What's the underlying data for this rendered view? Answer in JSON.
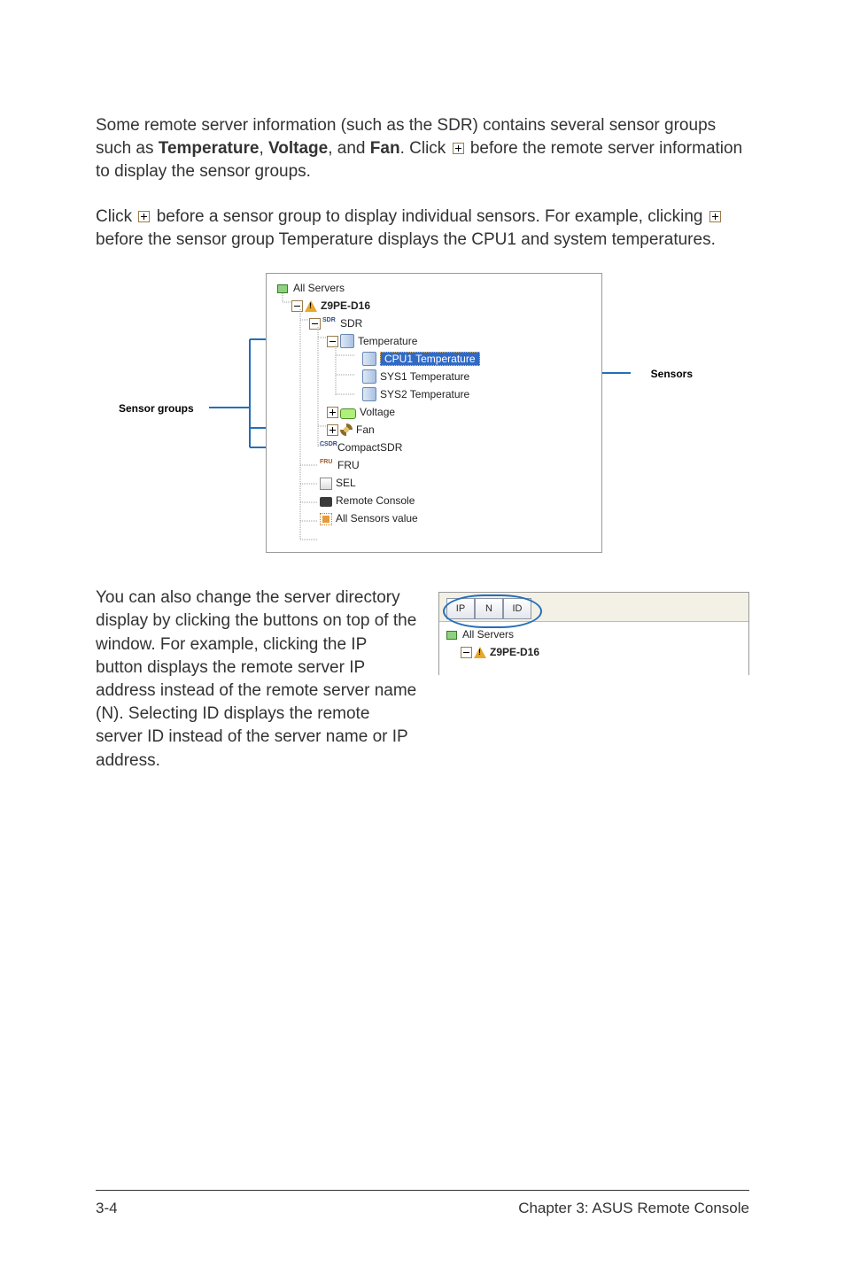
{
  "paragraphs": {
    "p1a": "Some remote server information (such as the SDR) contains several sensor groups such as ",
    "p1b": ", ",
    "p1c": ", and ",
    "p1d": ". Click ",
    "p1e": " before the remote server information to display the sensor groups.",
    "bold_temp": "Temperature",
    "bold_volt": "Voltage",
    "bold_fan": "Fan",
    "p2a": "Click ",
    "p2b": " before a sensor group to display individual sensors. For example, clicking ",
    "p2c": " before the sensor group Temperature displays the CPU1 and system temperatures.",
    "p3": "You can also change the server directory display by clicking the buttons on top of the window. For example, clicking the IP button displays the remote server IP address instead of the remote server name (N). Selecting ID displays the remote server ID instead of the server name or IP address."
  },
  "diagram": {
    "label_sensor_groups": "Sensor groups",
    "label_sensors": "Sensors"
  },
  "tree": {
    "all_servers": "All Servers",
    "server": "Z9PE-D16",
    "sdr": "SDR",
    "temperature": "Temperature",
    "cpu1": "CPU1 Temperature",
    "sys1": "SYS1 Temperature",
    "sys2": "SYS2 Temperature",
    "voltage": "Voltage",
    "fan": "Fan",
    "compact": "CompactSDR",
    "fru": "FRU",
    "sel": "SEL",
    "remote": "Remote Console",
    "allsens": "All Sensors value"
  },
  "smallpanel": {
    "tabs": {
      "ip": "IP",
      "n": "N",
      "id": "ID"
    },
    "all_servers": "All Servers",
    "server": "Z9PE-D16"
  },
  "footer": {
    "left": "3-4",
    "right": "Chapter 3: ASUS Remote Console"
  }
}
